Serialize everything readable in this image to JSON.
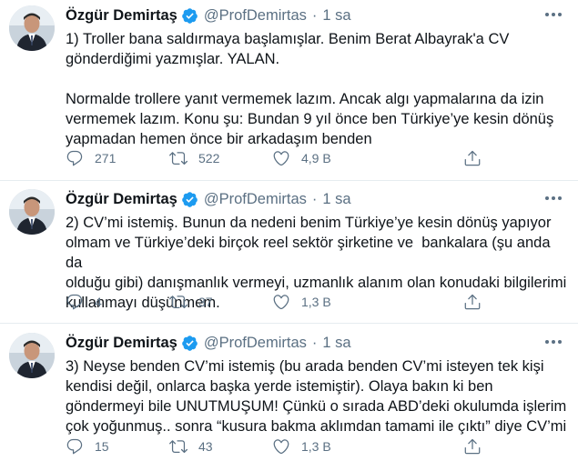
{
  "tweets": [
    {
      "name": "Özgür Demirtaş",
      "handle": "@ProfDemirtas",
      "separator": "·",
      "time": "1 sa",
      "text": "1) Troller bana saldırmaya başlamışlar. Benim Berat Albayrak'a CV\ngönderdiğimi yazmışlar. YALAN.\n\nNormalde trollere yanıt vermemek lazım. Ancak algı yapmalarına da izin\nvermemek lazım. Konu şu: Bundan 9 yıl önce ben Türkiye’ye kesin dönüş\nyapmadan hemen önce bir arkadaşım benden",
      "replies": "271",
      "retweets": "522",
      "likes": "4,9 B"
    },
    {
      "name": "Özgür Demirtaş",
      "handle": "@ProfDemirtas",
      "separator": "·",
      "time": "1 sa",
      "text": "2) CV’mi istemiş. Bunun da nedeni benim Türkiye’ye kesin dönüş yapıyor\nolmam ve Türkiye’deki birçok reel sektör şirketine ve  bankalara (şu anda da\nolduğu gibi) danışmanlık vermeyi, uzmanlık alanım olan konudaki bilgilerimi\nkullanmayı düşünmem.",
      "replies": "4",
      "retweets": "37",
      "likes": "1,3 B"
    },
    {
      "name": "Özgür Demirtaş",
      "handle": "@ProfDemirtas",
      "separator": "·",
      "time": "1 sa",
      "text": "3) Neyse benden CV’mi istemiş (bu arada benden CV’mi isteyen tek kişi\nkendisi değil, onlarca başka yerde istemiştir). Olaya bakın ki ben\ngöndermeyi bile UNUTMUŞUM! Çünkü o sırada ABD’deki okulumda işlerim\nçok yoğunmuş.. sonra “kusura bakma aklımdan tamami ile çıktı” diye CV’mi",
      "replies": "15",
      "retweets": "43",
      "likes": "1,3 B"
    }
  ],
  "colors": {
    "text": "#0f1419",
    "muted": "#5b7083",
    "verified": "#1d9bf0",
    "divider": "#e6ecf0"
  },
  "icons": {
    "verified": "verified-badge-icon",
    "more": "more-dots-icon",
    "reply": "reply-icon",
    "retweet": "retweet-icon",
    "like": "heart-icon",
    "share": "share-icon"
  }
}
